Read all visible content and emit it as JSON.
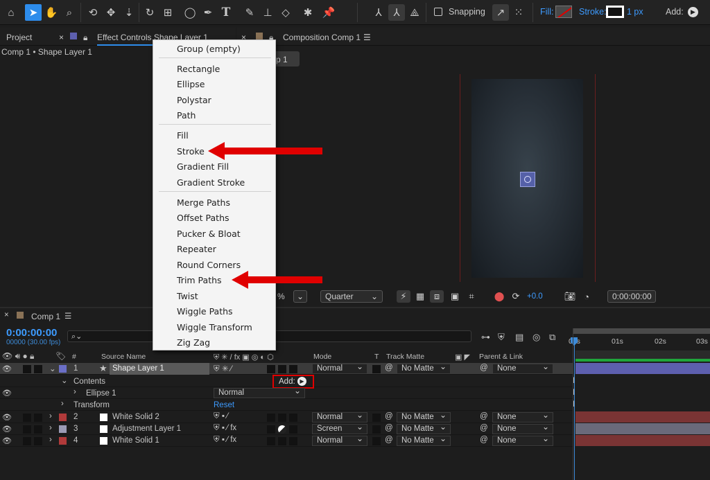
{
  "toolbar": {
    "snapping_label": "Snapping",
    "fill_label": "Fill:",
    "stroke_label": "Stroke:",
    "stroke_width": "1 px",
    "add_label": "Add:"
  },
  "left_panel": {
    "tab_project": "Project",
    "tab_effect_controls": "Effect Controls Shape Layer 1",
    "breadcrumb": "Comp 1 • Shape Layer 1"
  },
  "comp_panel": {
    "tab_label": "Composition Comp 1",
    "subtab_label": "p 1",
    "zoom_suffix": "%",
    "resolution": "Quarter",
    "exposure": "+0.0",
    "timecode": "0:00:00:00"
  },
  "add_menu": {
    "items": [
      "Group (empty)",
      "Rectangle",
      "Ellipse",
      "Polystar",
      "Path",
      "Fill",
      "Stroke",
      "Gradient Fill",
      "Gradient Stroke",
      "Merge Paths",
      "Offset Paths",
      "Pucker & Bloat",
      "Repeater",
      "Round Corners",
      "Trim Paths",
      "Twist",
      "Wiggle Paths",
      "Wiggle Transform",
      "Zig Zag"
    ]
  },
  "timeline": {
    "tab_label": "Comp 1",
    "current_time": "0:00:00:00",
    "frame_info": "00000 (30.00 fps)",
    "search_placeholder": "",
    "ruler": [
      "00s",
      "01s",
      "02s",
      "03s"
    ],
    "headers": {
      "num": "#",
      "source_name": "Source Name",
      "mode": "Mode",
      "t": "T",
      "track_matte": "Track Matte",
      "parent_link": "Parent & Link"
    },
    "layers": [
      {
        "num": "1",
        "name": "Shape Layer 1",
        "mode": "Normal",
        "matte": "No Matte",
        "parent": "None",
        "color": "#6b6fc7"
      },
      {
        "num": "2",
        "name": "White Solid 2",
        "mode": "Normal",
        "matte": "No Matte",
        "parent": "None",
        "color": "#b03a3a"
      },
      {
        "num": "3",
        "name": "Adjustment Layer 1",
        "mode": "Screen",
        "matte": "No Matte",
        "parent": "None",
        "color": "#9b9bb5"
      },
      {
        "num": "4",
        "name": "White Solid 1",
        "mode": "Normal",
        "matte": "No Matte",
        "parent": "None",
        "color": "#b03a3a"
      }
    ],
    "contents_label": "Contents",
    "add_inline_label": "Add:",
    "ellipse_label": "Ellipse 1",
    "ellipse_mode": "Normal",
    "transform_label": "Transform",
    "reset_label": "Reset"
  },
  "colors": {
    "accent": "#2d8ceb",
    "annotation_red": "#e00000",
    "shape_bar": "#5d5fae",
    "solid_bar": "#7a3434",
    "adjust_bar": "#6a6a7a"
  }
}
